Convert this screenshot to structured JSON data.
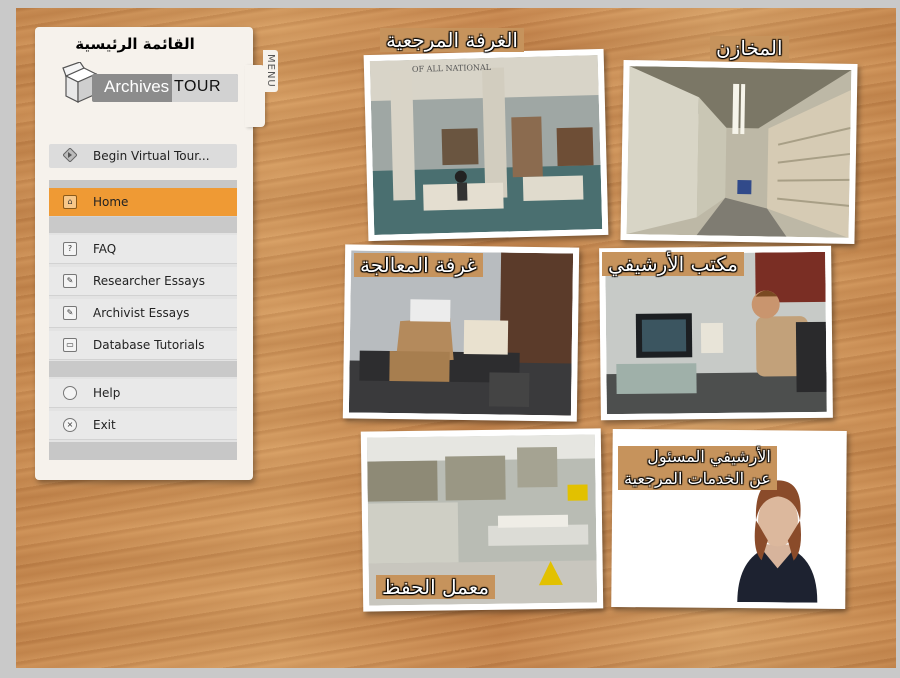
{
  "menu": {
    "arabic_title": "القائمة الرئيسية",
    "tab_label": "MENU",
    "logo_word1": "Archives",
    "logo_word2": "TOUR",
    "begin_label": "Begin Virtual Tour...",
    "items": [
      {
        "label": "Home",
        "icon": "home-icon",
        "active": true
      },
      {
        "label": "FAQ",
        "icon": "faq-icon"
      },
      {
        "label": "Researcher Essays",
        "icon": "researcher-essay-icon"
      },
      {
        "label": "Archivist Essays",
        "icon": "archivist-essay-icon"
      },
      {
        "label": "Database Tutorials",
        "icon": "monitor-icon"
      },
      {
        "label": "Help",
        "icon": "help-icon"
      },
      {
        "label": "Exit",
        "icon": "exit-icon"
      }
    ]
  },
  "tiles": {
    "reference_room": "الغرفة المرجعية",
    "stacks": "المخازن",
    "processing_room": "غرفة المعالجة",
    "archivist_office": "مكتب الأرشيفي",
    "conservation_lab": "معمل الحفظ",
    "reference_archivist_line1": "الأرشيفي المسئول",
    "reference_archivist_line2": "عن الخدمات المرجعية",
    "sign_text": "OF ALL NATIONAL"
  },
  "colors": {
    "active_item": "#ef9a34",
    "wood": "#cf9258"
  }
}
